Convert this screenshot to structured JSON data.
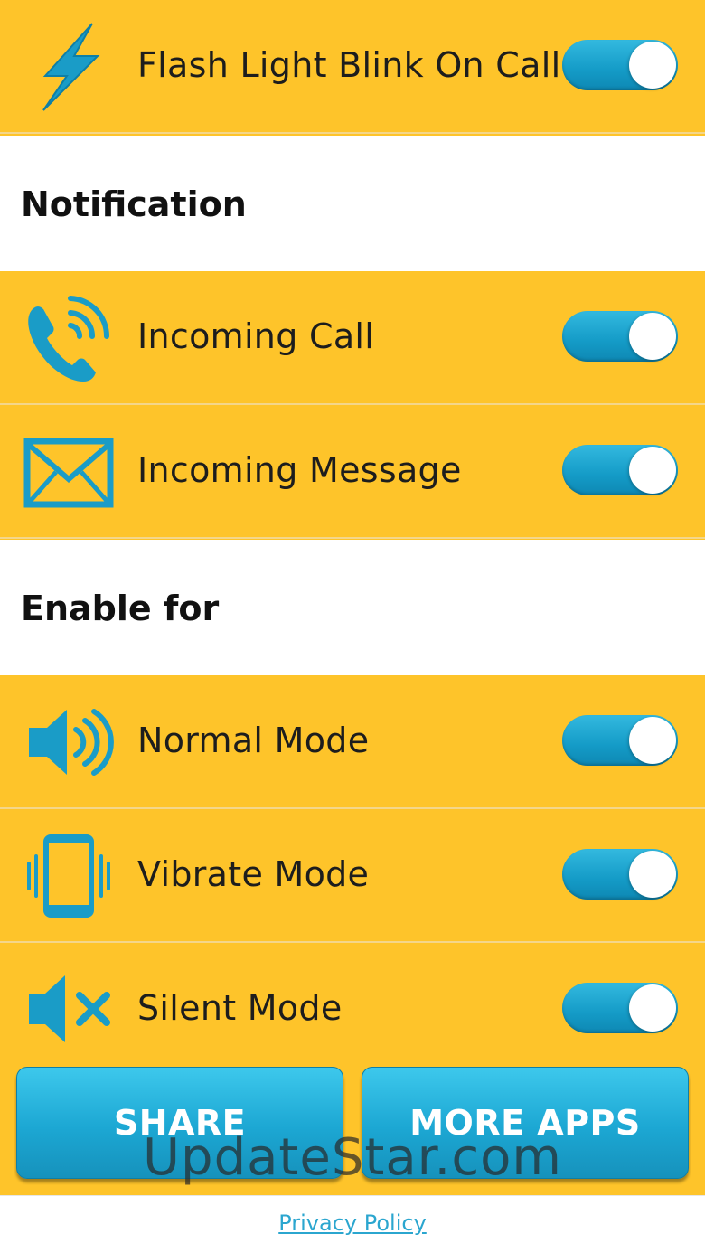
{
  "header": {
    "label": "Flash Light Blink On Call",
    "toggle_on": true
  },
  "notification": {
    "title": "Notification",
    "items": [
      {
        "label": "Incoming Call",
        "icon": "phone-ringing-icon",
        "toggle_on": true
      },
      {
        "label": "Incoming Message",
        "icon": "envelope-icon",
        "toggle_on": true
      }
    ]
  },
  "enable_for": {
    "title": "Enable for",
    "items": [
      {
        "label": "Normal Mode",
        "icon": "speaker-icon",
        "toggle_on": true
      },
      {
        "label": "Vibrate Mode",
        "icon": "phone-vibrate-icon",
        "toggle_on": true
      },
      {
        "label": "Silent Mode",
        "icon": "speaker-muted-icon",
        "toggle_on": true
      }
    ]
  },
  "buttons": {
    "share": "SHARE",
    "more_apps": "MORE APPS"
  },
  "watermark": "UpdateStar.com",
  "footer": {
    "privacy": "Privacy Policy"
  },
  "colors": {
    "background": "#FEC42A",
    "accent": "#1CA7D3",
    "icon": "#1A9CC7",
    "link": "#2BA6CF"
  }
}
